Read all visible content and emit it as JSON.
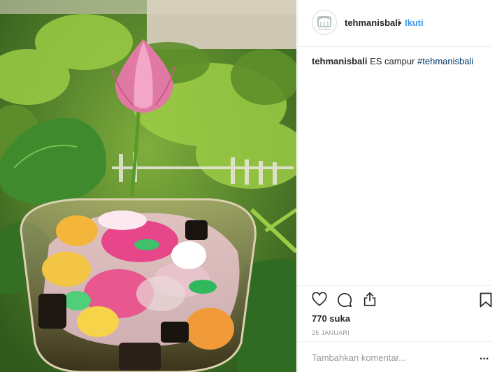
{
  "post": {
    "username": "tehmanisbali",
    "separator": "•",
    "follow_label": "Ikuti",
    "avatar_text": "Teh Manis",
    "caption": {
      "username": "tehmanisbali",
      "text": "ES campur",
      "hashtag": "#tehmanisbali"
    },
    "likes": "770 suka",
    "date": "25 JANUARI",
    "comment_placeholder": "Tambahkan komentar...",
    "more_label": "..."
  },
  "icons": [
    "heart-icon",
    "comment-icon",
    "share-icon",
    "bookmark-icon"
  ],
  "colors": {
    "link": "#3897f0",
    "hashtag": "#003569",
    "text": "#262626",
    "muted": "#999999",
    "border": "#efefef"
  }
}
